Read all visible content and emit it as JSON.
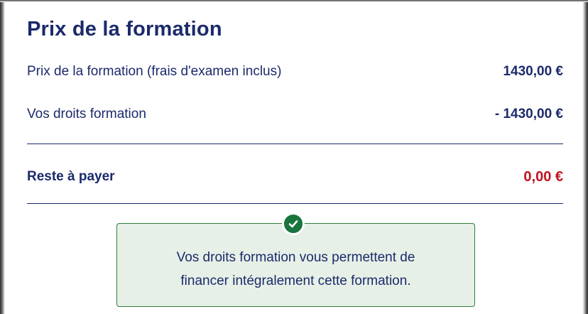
{
  "section": {
    "title": "Prix de la formation"
  },
  "rows": [
    {
      "label": "Prix de la formation (frais d'examen inclus)",
      "value": "1430,00 €"
    },
    {
      "label": "Vos droits formation",
      "value": "- 1430,00 €"
    }
  ],
  "total": {
    "label": "Reste à payer",
    "value": "0,00 €",
    "value_color": "#c1121f"
  },
  "notice": {
    "icon": "check-circle-icon",
    "line1": "Vos droits formation vous permettent de",
    "line2": "financer intégralement cette formation.",
    "accent": "#18753c"
  }
}
